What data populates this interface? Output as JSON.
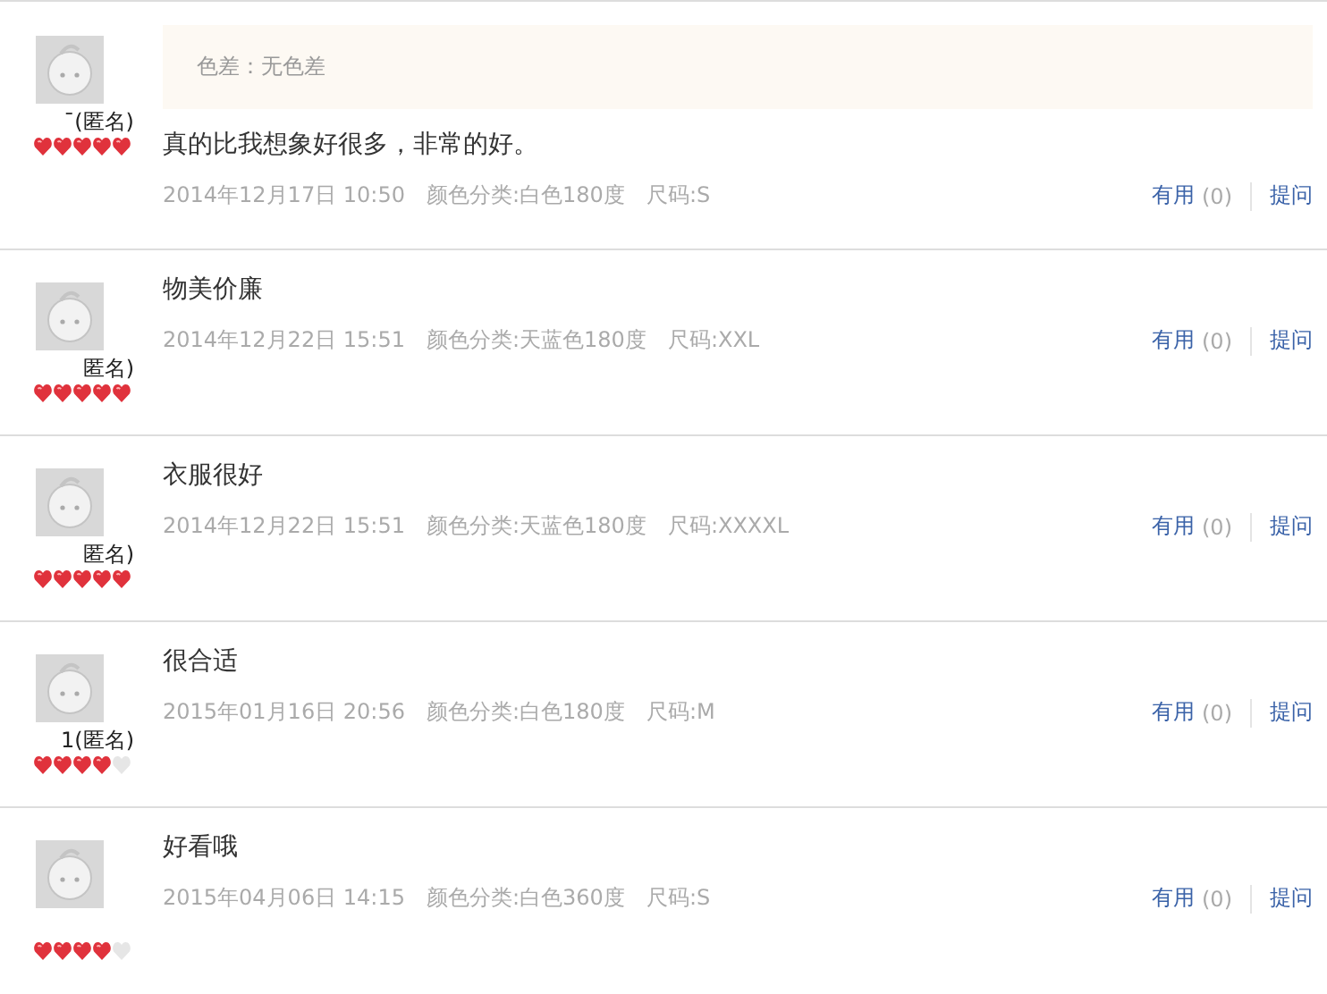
{
  "reviews": [
    {
      "user": "ˉ(匿名)",
      "stars": 5,
      "append": "色差：无色差",
      "comment": "真的比我想象好很多，非常的好。",
      "date": "2014年12月17日 10:50",
      "variant": "颜色分类:白色180度",
      "size": "尺码:S",
      "useful": "有用",
      "count": "(0)",
      "ask": "提问"
    },
    {
      "user": "匿名)",
      "stars": 5,
      "comment": "物美价廉",
      "date": "2014年12月22日 15:51",
      "variant": "颜色分类:天蓝色180度",
      "size": "尺码:XXL",
      "useful": "有用",
      "count": "(0)",
      "ask": "提问"
    },
    {
      "user": "匿名)",
      "stars": 5,
      "comment": "衣服很好",
      "date": "2014年12月22日 15:51",
      "variant": "颜色分类:天蓝色180度",
      "size": "尺码:XXXXL",
      "useful": "有用",
      "count": "(0)",
      "ask": "提问"
    },
    {
      "user": "1(匿名)",
      "stars": 4,
      "comment": "很合适",
      "date": "2015年01月16日 20:56",
      "variant": "颜色分类:白色180度",
      "size": "尺码:M",
      "useful": "有用",
      "count": "(0)",
      "ask": "提问"
    },
    {
      "stars": 4,
      "comment": "好看哦",
      "date": "2015年04月06日 14:15",
      "variant": "颜色分类:白色360度",
      "size": "尺码:S",
      "useful": "有用",
      "count": "(0)",
      "ask": "提问"
    }
  ]
}
